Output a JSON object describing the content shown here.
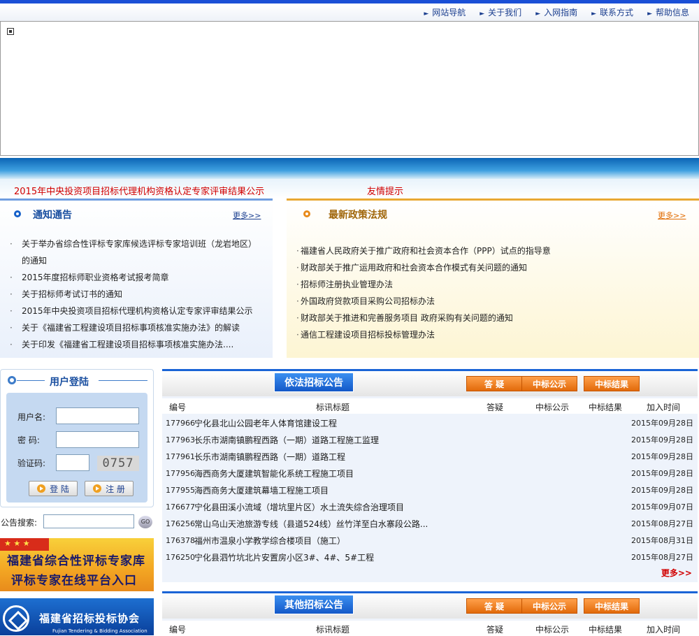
{
  "topnav": {
    "items": [
      "网站导航",
      "关于我们",
      "入网指南",
      "联系方式",
      "帮助信息"
    ]
  },
  "marquee": {
    "headline": "2015年中央投资项目招标代理机构资格认定专家评审结果公示",
    "tip": "友情提示"
  },
  "notice": {
    "title": "通知通告",
    "more": "更多>>",
    "items": [
      "关于举办省综合性评标专家库候选评标专家培训班（龙岩地区）的通知",
      "2015年度招标师职业资格考试报考简章",
      "关于招标师考试订书的通知",
      "2015年中央投资项目招标代理机构资格认定专家评审结果公示",
      "关于《福建省工程建设项目招标事项核准实施办法》的解读",
      "关于印发《福建省工程建设项目招标事项核准实施办法...."
    ]
  },
  "policy": {
    "title": "最新政策法规",
    "more": "更多>>",
    "items": [
      "福建省人民政府关于推广政府和社会资本合作（PPP）试点的指导意",
      "财政部关于推广运用政府和社会资本合作模式有关问题的通知",
      "招标师注册执业管理办法",
      "外国政府贷款项目采购公司招标办法",
      "财政部关于推进和完善服务项目 政府采购有关问题的通知",
      "通信工程建设项目招标投标管理办法"
    ]
  },
  "login": {
    "title": "用户登陆",
    "username_label": "用户名:",
    "password_label": "密  码:",
    "captcha_label": "验证码:",
    "captcha_text": "0757",
    "login_btn": "登 陆",
    "register_btn": "注 册"
  },
  "search": {
    "label": "公告搜索:",
    "go": "GO"
  },
  "ads": {
    "expert_line1": "福建省综合性评标专家库",
    "expert_line2": "评标专家在线平台入口",
    "assoc_name": "福建省招标投标协会",
    "assoc_en": "Fujian Tendering & Bidding Association"
  },
  "legal_table": {
    "title": "依法招标公告",
    "buttons": [
      "答  疑",
      "中标公示",
      "中标结果"
    ],
    "columns": [
      "编号",
      "标讯标题",
      "答疑",
      "中标公示",
      "中标结果",
      "加入时间"
    ],
    "rows": [
      {
        "id": "177966",
        "title": "宁化县北山公园老年人体育馆建设工程",
        "date": "2015年09月28日"
      },
      {
        "id": "177963",
        "title": "长乐市湖南镇鹏程西路（一期）道路工程施工监理",
        "date": "2015年09月28日"
      },
      {
        "id": "177961",
        "title": "长乐市湖南镇鹏程西路（一期）道路工程",
        "date": "2015年09月28日"
      },
      {
        "id": "177956",
        "title": "海西商务大厦建筑智能化系统工程施工项目",
        "date": "2015年09月28日"
      },
      {
        "id": "177955",
        "title": "海西商务大厦建筑幕墙工程施工项目",
        "date": "2015年09月28日"
      },
      {
        "id": "176677",
        "title": "宁化县田溪小流域（增坑里片区）水土流失综合治理项目",
        "date": "2015年09月07日"
      },
      {
        "id": "176256",
        "title": "常山乌山天池旅游专线（县道524线）丝竹洋至白水寨段公路...",
        "date": "2015年08月27日"
      },
      {
        "id": "176378",
        "title": "福州市温泉小学教学综合楼项目（施工）",
        "date": "2015年08月31日"
      },
      {
        "id": "176250",
        "title": "宁化县泗竹坑北片安置房小区3#、4#、5#工程",
        "date": "2015年08月27日"
      }
    ],
    "more": "更多>>"
  },
  "other_table": {
    "title": "其他招标公告",
    "buttons": [
      "答  疑",
      "中标公示",
      "中标结果"
    ],
    "columns": [
      "编号",
      "标讯标题",
      "答疑",
      "中标公示",
      "中标结果",
      "加入时间"
    ]
  }
}
